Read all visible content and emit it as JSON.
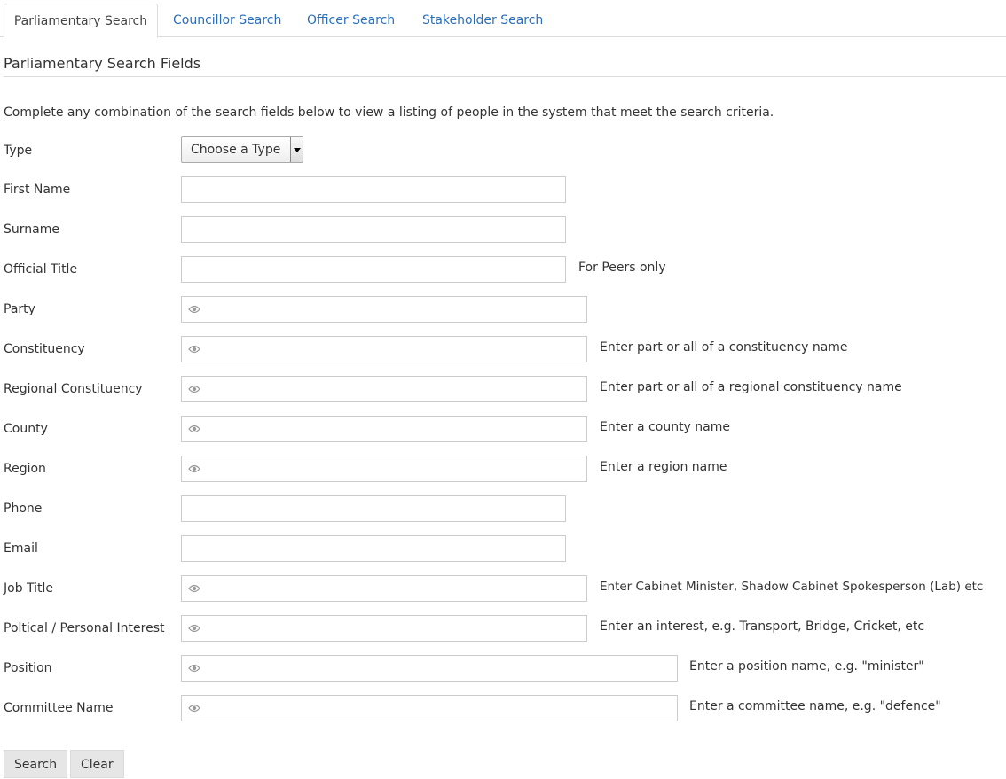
{
  "tabs": [
    {
      "label": "Parliamentary Search",
      "active": true
    },
    {
      "label": "Councillor Search",
      "active": false
    },
    {
      "label": "Officer Search",
      "active": false
    },
    {
      "label": "Stakeholder Search",
      "active": false
    }
  ],
  "section_title": "Parliamentary Search Fields",
  "intro": "Complete any combination of the search fields below to view a listing of people in the system that meet the search criteria.",
  "fields": {
    "type": {
      "label": "Type",
      "selected": "Choose a Type"
    },
    "first_name": {
      "label": "First Name",
      "value": ""
    },
    "surname": {
      "label": "Surname",
      "value": ""
    },
    "official_title": {
      "label": "Official Title",
      "value": "",
      "help": "For Peers only"
    },
    "party": {
      "label": "Party",
      "value": ""
    },
    "constituency": {
      "label": "Constituency",
      "value": "",
      "help": "Enter part or all of a constituency name"
    },
    "regional_constituency": {
      "label": "Regional Constituency",
      "value": "",
      "help": "Enter part or all of a regional constituency name"
    },
    "county": {
      "label": "County",
      "value": "",
      "help": "Enter a county name"
    },
    "region": {
      "label": "Region",
      "value": "",
      "help": "Enter a region name"
    },
    "phone": {
      "label": "Phone",
      "value": ""
    },
    "email": {
      "label": "Email",
      "value": ""
    },
    "job_title": {
      "label": "Job Title",
      "value": "",
      "help": "Enter Cabinet Minister, Shadow Cabinet Spokesperson (Lab) etc"
    },
    "interest": {
      "label": "Poltical / Personal Interest",
      "value": "",
      "help": "Enter an interest, e.g. Transport, Bridge, Cricket, etc"
    },
    "position": {
      "label": "Position",
      "value": "",
      "help": "Enter a position name, e.g. \"minister\""
    },
    "committee_name": {
      "label": "Committee Name",
      "value": "",
      "help": "Enter a committee name, e.g. \"defence\""
    }
  },
  "buttons": {
    "search": "Search",
    "clear": "Clear"
  },
  "icons": {
    "autocomplete": "eye-icon",
    "select": "chevron-down-icon"
  },
  "colors": {
    "link": "#2a6ebb",
    "border": "#cccccc",
    "button_bg": "#e6e6e6"
  }
}
